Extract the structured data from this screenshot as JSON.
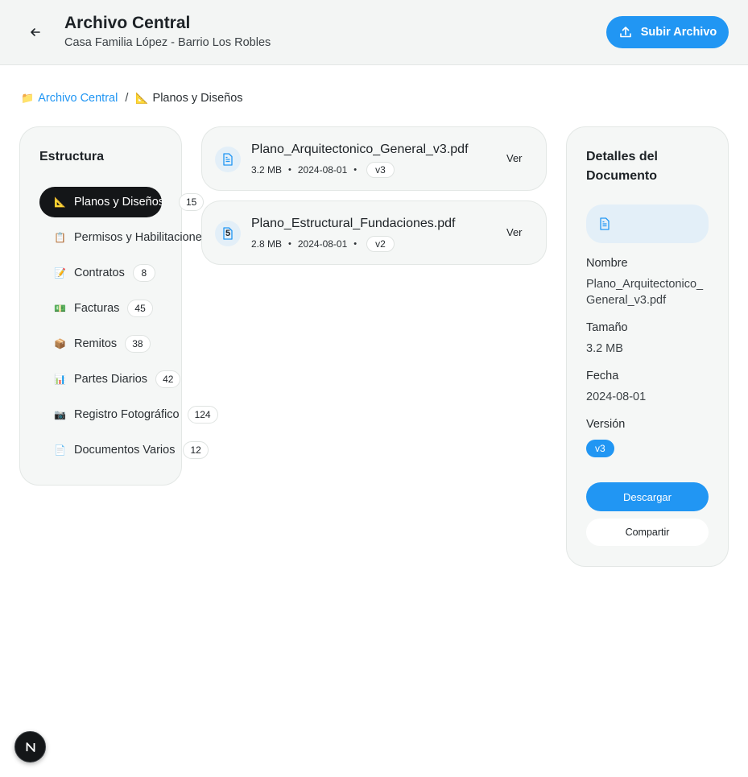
{
  "header": {
    "title": "Archivo Central",
    "subtitle": "Casa Familia López - Barrio Los Robles",
    "upload_label": "Subir Archivo",
    "back_icon": "arrow-left-icon",
    "upload_icon": "upload-icon"
  },
  "breadcrumb": {
    "root_emoji": "📁",
    "root_label": "Archivo Central",
    "separator": "/",
    "current_emoji": "📐",
    "current_label": "Planos y Diseños"
  },
  "sidebar": {
    "title": "Estructura",
    "items": [
      {
        "emoji": "📐",
        "label": "Planos y Diseños",
        "count": "15",
        "active": true
      },
      {
        "emoji": "📋",
        "label": "Permisos y Habilitaciones",
        "count": "",
        "active": false
      },
      {
        "emoji": "📝",
        "label": "Contratos",
        "count": "8",
        "active": false
      },
      {
        "emoji": "💵",
        "label": "Facturas",
        "count": "45",
        "active": false
      },
      {
        "emoji": "📦",
        "label": "Remitos",
        "count": "38",
        "active": false
      },
      {
        "emoji": "📊",
        "label": "Partes Diarios",
        "count": "42",
        "active": false
      },
      {
        "emoji": "📷",
        "label": "Registro Fotográfico",
        "count": "124",
        "active": false
      },
      {
        "emoji": "📄",
        "label": "Documentos Varios",
        "count": "12",
        "active": false
      }
    ]
  },
  "files": [
    {
      "name": "Plano_Arquitectonico_General_v3.pdf",
      "size": "3.2 MB",
      "date": "2024-08-01",
      "version": "v3",
      "action": "Ver",
      "icon_badge": ""
    },
    {
      "name": "Plano_Estructural_Fundaciones.pdf",
      "size": "2.8 MB",
      "date": "2024-08-01",
      "version": "v2",
      "action": "Ver",
      "icon_badge": "5"
    }
  ],
  "details": {
    "title": "Detalles del Documento",
    "name_label": "Nombre",
    "name_value": "Plano_Arquitectonico_General_v3.pdf",
    "size_label": "Tamaño",
    "size_value": "3.2 MB",
    "date_label": "Fecha",
    "date_value": "2024-08-01",
    "version_label": "Versión",
    "version_value": "v3",
    "download_label": "Descargar",
    "share_label": "Compartir"
  },
  "dev_badge": {
    "label": "N"
  },
  "colors": {
    "accent": "#2196f3",
    "active_nav": "#141618",
    "panel_bg": "#f5f7f6",
    "header_bg": "#f3f5f4"
  }
}
